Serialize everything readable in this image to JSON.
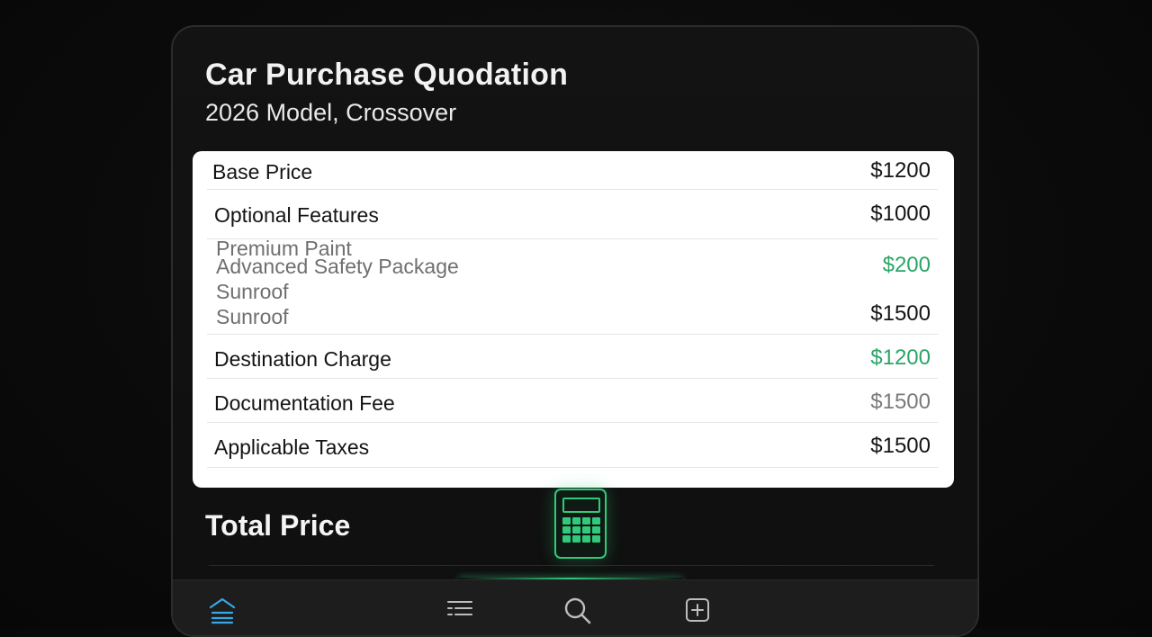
{
  "header": {
    "title": "Car Purchase Quodation",
    "subtitle": "2026 Model, Crossover"
  },
  "quote": {
    "rows": [
      {
        "label": "Base Price",
        "value": "$1200"
      },
      {
        "label": "Optional Features",
        "value": "$1000"
      },
      {
        "sub_items": [
          "Premium Paint",
          "Advanced Safety Package",
          "Sunroof",
          "Sunroof"
        ],
        "values": [
          "$200",
          "$1500"
        ]
      },
      {
        "label": "Destination Charge",
        "value": "$1200"
      },
      {
        "label": "Documentation Fee",
        "value": "$1500"
      },
      {
        "label": "Applicable Taxes",
        "value": "$1500"
      }
    ]
  },
  "total": {
    "label": "Total Price"
  },
  "colors": {
    "accent_green": "#2ba567",
    "active_tab_blue": "#3aa8e8",
    "calculator_green": "#31c97b"
  },
  "tabbar": {
    "icons": [
      "home-icon",
      "list-icon",
      "search-icon",
      "add-icon"
    ],
    "active": "home-icon"
  }
}
